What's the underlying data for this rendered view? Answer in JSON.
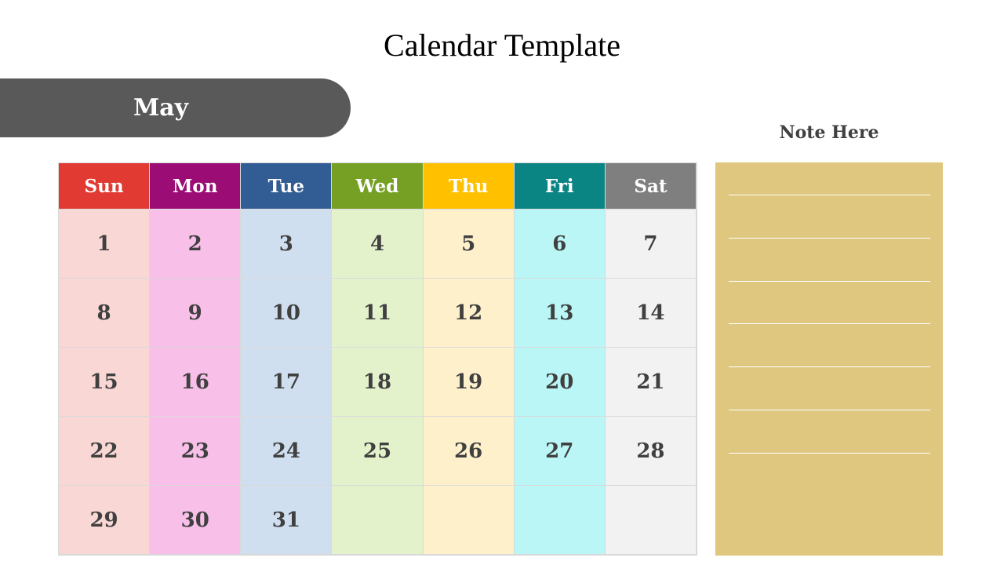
{
  "title": "Calendar Template",
  "month": "May",
  "weekdays": [
    "Sun",
    "Mon",
    "Tue",
    "Wed",
    "Thu",
    "Fri",
    "Sat"
  ],
  "weeks": [
    [
      "1",
      "2",
      "3",
      "4",
      "5",
      "6",
      "7"
    ],
    [
      "8",
      "9",
      "10",
      "11",
      "12",
      "13",
      "14"
    ],
    [
      "15",
      "16",
      "17",
      "18",
      "19",
      "20",
      "21"
    ],
    [
      "22",
      "23",
      "24",
      "25",
      "26",
      "27",
      "28"
    ],
    [
      "29",
      "30",
      "31",
      "",
      "",
      "",
      ""
    ]
  ],
  "colors": {
    "header": [
      "#e03a32",
      "#9b0d75",
      "#325d94",
      "#76a024",
      "#ffc000",
      "#0b8484",
      "#7f7f7f"
    ],
    "column": [
      "#f8d7d4",
      "#f8bfe9",
      "#d0dfef",
      "#e4f2cc",
      "#fff0cc",
      "#bbf6f6",
      "#f2f2f2"
    ],
    "banner": "#595959",
    "note": "#dfc77f"
  },
  "notes": {
    "title": "Note Here",
    "line_count": 7
  }
}
